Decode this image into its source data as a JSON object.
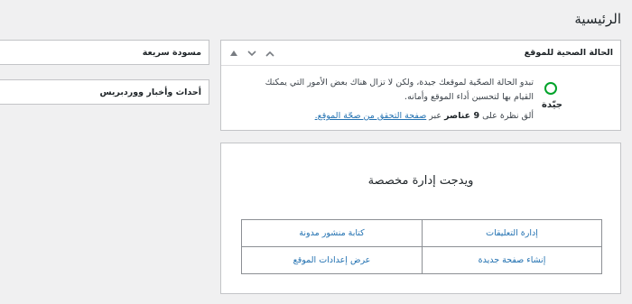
{
  "page": {
    "title": "الرئيسية"
  },
  "site_health": {
    "title": "الحالة الصحية للموقع",
    "status_label": "جيّدة",
    "description": "تبدو الحالة الصحّية لموقعك جيدة، ولكن لا تزال هناك بعض الأمور التي يمكنك القيام بها لتحسين أداء الموقع وأمانه.",
    "link_prefix": "ألق نظرة على",
    "items_count": "9 عناصر",
    "link_middle": "عبر",
    "link_text": "صفحة التحقق من صحّة الموقع."
  },
  "quick_draft": {
    "title": "مسودة سريعة"
  },
  "wp_news": {
    "title": "أحداث وأخبار ووردبريس"
  },
  "custom_widget": {
    "title": "ويدجت إدارة مخصصة",
    "links": [
      "إدارة التعليقات",
      "كتابة منشور مدونة",
      "إنشاء صفحة جديدة",
      "عرض إعدادات الموقع"
    ]
  },
  "colors": {
    "good": "#00a32a",
    "link": "#2271b1"
  }
}
